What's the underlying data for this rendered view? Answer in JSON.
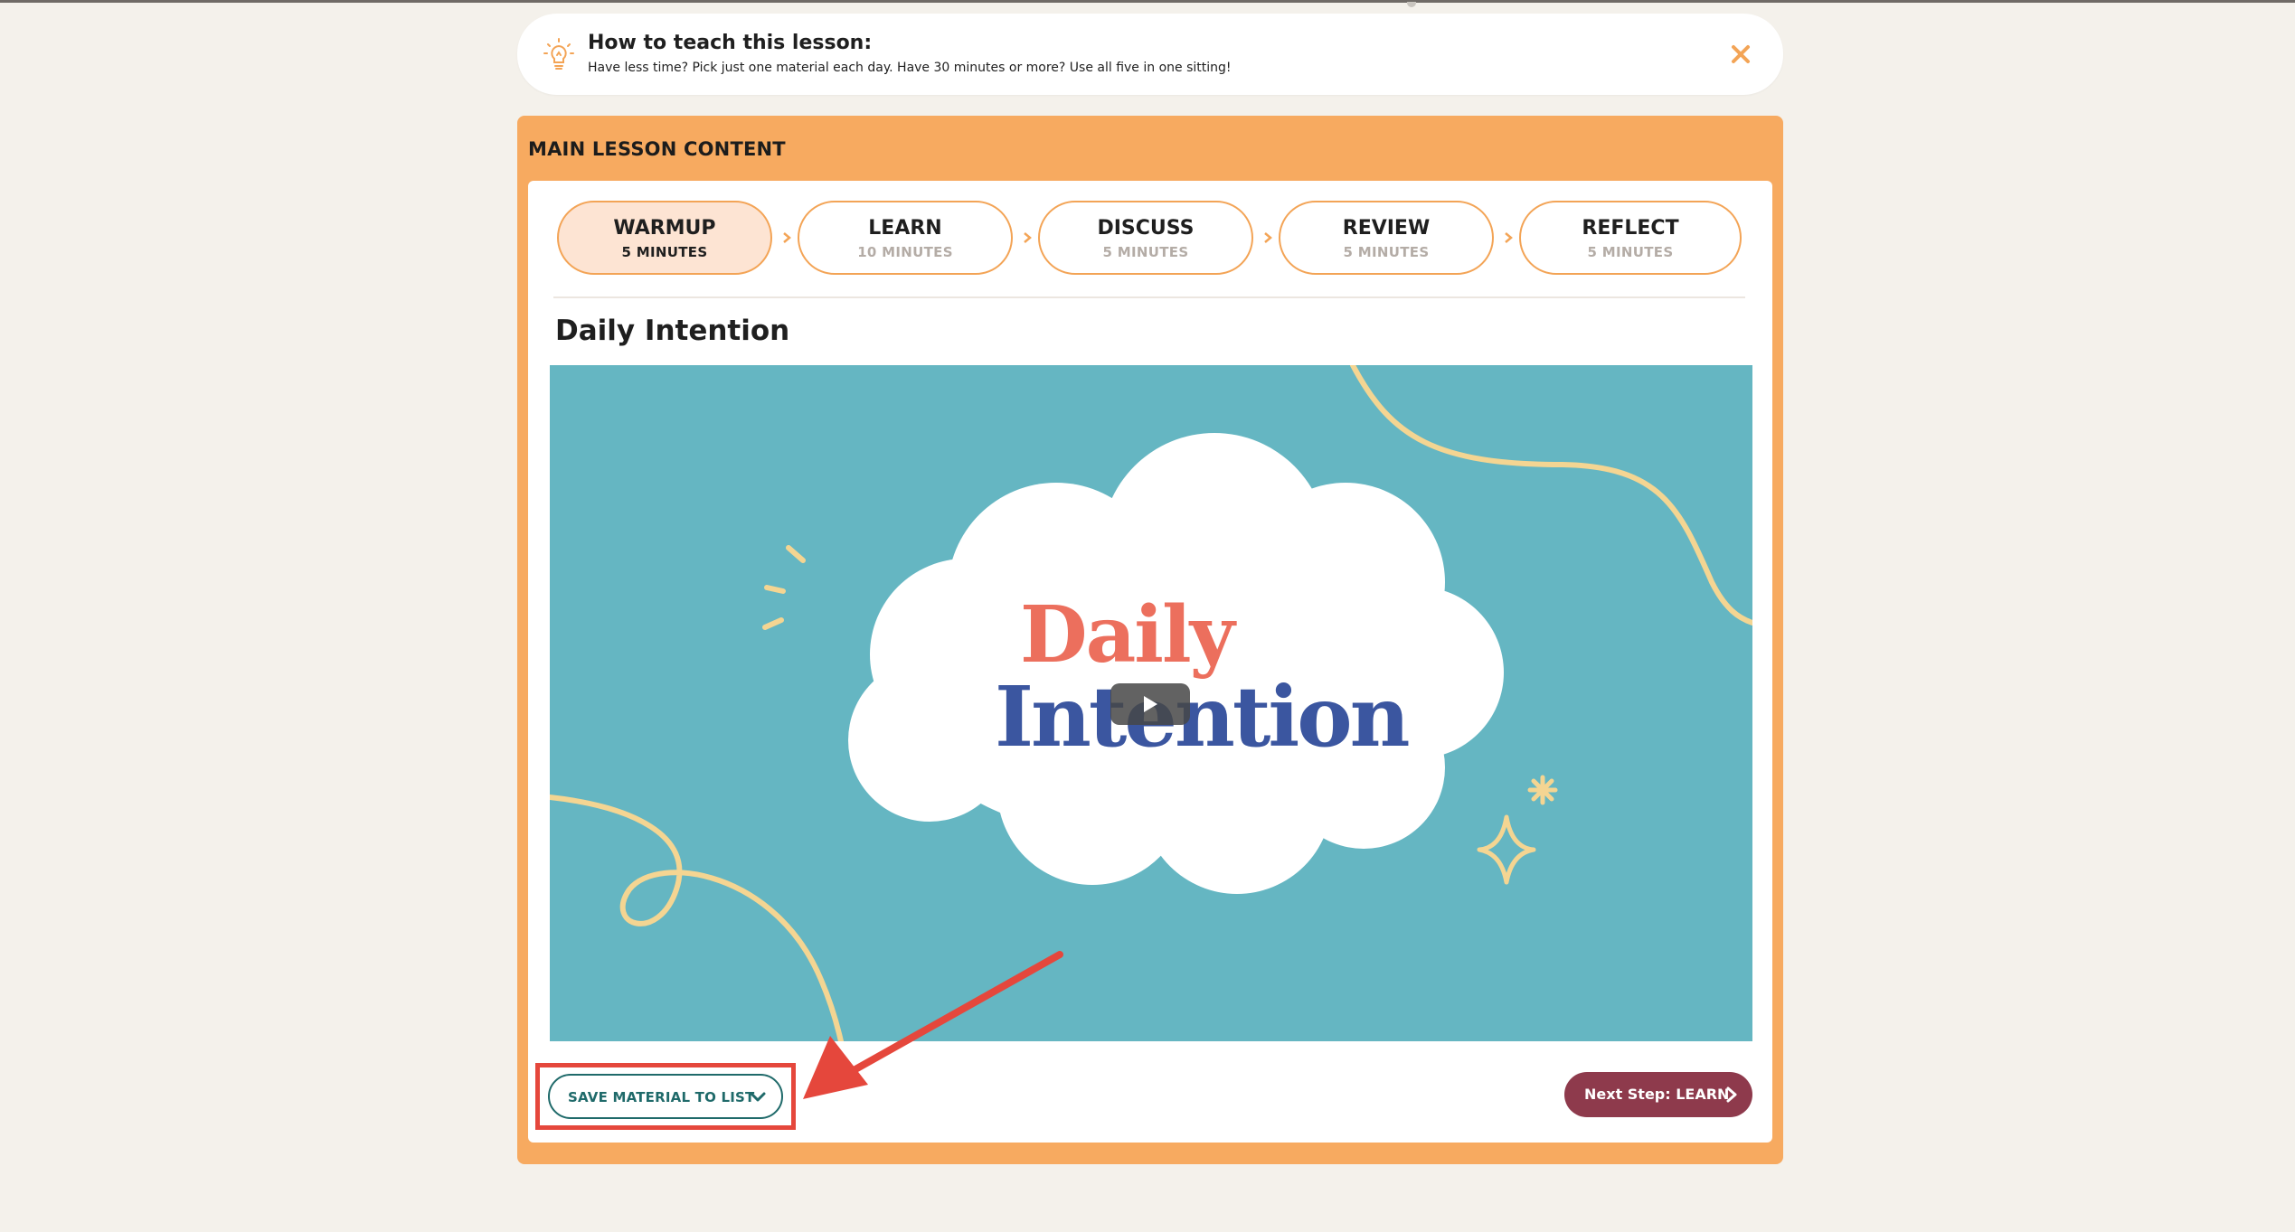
{
  "tip": {
    "icon": "lightbulb-icon",
    "title": "How to teach this lesson:",
    "text": "Have less time? Pick just one material each day. Have 30 minutes or more? Use all five in one sitting!",
    "close_icon": "close-icon"
  },
  "panel": {
    "title": "MAIN LESSON CONTENT"
  },
  "steps": [
    {
      "name": "WARMUP",
      "duration": "5 MINUTES",
      "active": true
    },
    {
      "name": "LEARN",
      "duration": "10 MINUTES",
      "active": false
    },
    {
      "name": "DISCUSS",
      "duration": "5 MINUTES",
      "active": false
    },
    {
      "name": "REVIEW",
      "duration": "5 MINUTES",
      "active": false
    },
    {
      "name": "REFLECT",
      "duration": "5 MINUTES",
      "active": false
    }
  ],
  "material": {
    "title": "Daily Intention",
    "video": {
      "title_line1": "Daily",
      "title_line2": "Intention",
      "play_icon": "play-icon"
    }
  },
  "actions": {
    "save_label": "SAVE MATERIAL TO LIST",
    "next_label": "Next Step: LEARN"
  },
  "colors": {
    "page_bg": "#f4f1eb",
    "panel_orange": "#f7aa60",
    "active_step_bg": "#fde4d3",
    "video_teal": "#65b6c2",
    "save_teal": "#1f6a6a",
    "next_maroon": "#8e3a4c",
    "annotation_red": "#e5473c"
  }
}
